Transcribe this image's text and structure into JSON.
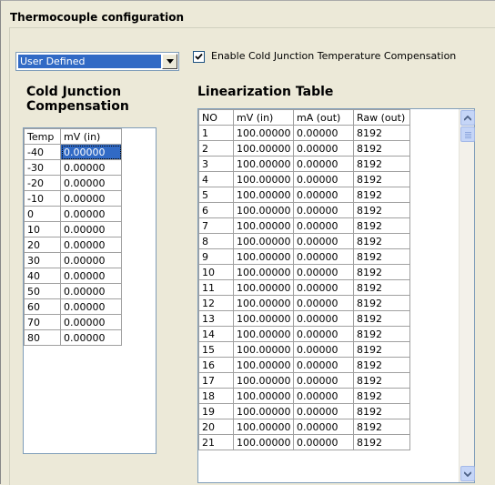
{
  "window": {
    "title": "Thermocouple configuration"
  },
  "type_select": {
    "value": "User Defined",
    "icon": "chevron-down-icon"
  },
  "cold_junction_checkbox": {
    "checked": true,
    "label": "Enable Cold Junction Temperature Compensation"
  },
  "cjc": {
    "heading_line1": "Cold Junction",
    "heading_line2": "Compensation",
    "columns": [
      "Temp",
      "mV (in)"
    ],
    "rows": [
      [
        "-40",
        "0.00000"
      ],
      [
        "-30",
        "0.00000"
      ],
      [
        "-20",
        "0.00000"
      ],
      [
        "-10",
        "0.00000"
      ],
      [
        "0",
        "0.00000"
      ],
      [
        "10",
        "0.00000"
      ],
      [
        "20",
        "0.00000"
      ],
      [
        "30",
        "0.00000"
      ],
      [
        "40",
        "0.00000"
      ],
      [
        "50",
        "0.00000"
      ],
      [
        "60",
        "0.00000"
      ],
      [
        "70",
        "0.00000"
      ],
      [
        "80",
        "0.00000"
      ]
    ]
  },
  "linearization": {
    "heading": "Linearization Table",
    "columns": [
      "NO",
      "mV (in)",
      "mA (out)",
      "Raw (out)"
    ],
    "rows": [
      [
        "1",
        "100.00000",
        "0.00000",
        "8192"
      ],
      [
        "2",
        "100.00000",
        "0.00000",
        "8192"
      ],
      [
        "3",
        "100.00000",
        "0.00000",
        "8192"
      ],
      [
        "4",
        "100.00000",
        "0.00000",
        "8192"
      ],
      [
        "5",
        "100.00000",
        "0.00000",
        "8192"
      ],
      [
        "6",
        "100.00000",
        "0.00000",
        "8192"
      ],
      [
        "7",
        "100.00000",
        "0.00000",
        "8192"
      ],
      [
        "8",
        "100.00000",
        "0.00000",
        "8192"
      ],
      [
        "9",
        "100.00000",
        "0.00000",
        "8192"
      ],
      [
        "10",
        "100.00000",
        "0.00000",
        "8192"
      ],
      [
        "11",
        "100.00000",
        "0.00000",
        "8192"
      ],
      [
        "12",
        "100.00000",
        "0.00000",
        "8192"
      ],
      [
        "13",
        "100.00000",
        "0.00000",
        "8192"
      ],
      [
        "14",
        "100.00000",
        "0.00000",
        "8192"
      ],
      [
        "15",
        "100.00000",
        "0.00000",
        "8192"
      ],
      [
        "16",
        "100.00000",
        "0.00000",
        "8192"
      ],
      [
        "17",
        "100.00000",
        "0.00000",
        "8192"
      ],
      [
        "18",
        "100.00000",
        "0.00000",
        "8192"
      ],
      [
        "19",
        "100.00000",
        "0.00000",
        "8192"
      ],
      [
        "20",
        "100.00000",
        "0.00000",
        "8192"
      ],
      [
        "21",
        "100.00000",
        "0.00000",
        "8192"
      ]
    ]
  },
  "colors": {
    "selection": "#316ac5",
    "panel": "#ece9d8",
    "grid_border": "#7f9db9"
  }
}
